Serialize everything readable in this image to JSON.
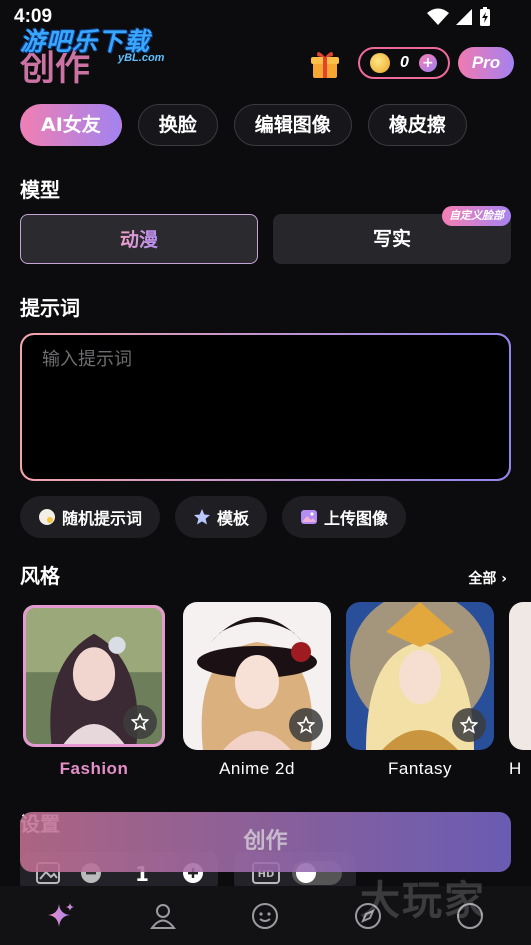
{
  "status_bar": {
    "time": "4:09"
  },
  "watermark": {
    "text": "游吧乐下载",
    "sub": "yBL.com",
    "corner": "大玩家"
  },
  "header": {
    "title": "创作",
    "coins": "0",
    "pro": "Pro"
  },
  "tabs": [
    {
      "label": "AI女友",
      "active": true
    },
    {
      "label": "换脸",
      "active": false
    },
    {
      "label": "编辑图像",
      "active": false
    },
    {
      "label": "橡皮擦",
      "active": false
    }
  ],
  "model": {
    "label": "模型",
    "options": [
      "动漫",
      "写实"
    ],
    "selected": "动漫",
    "custom_badge": "自定义脸部"
  },
  "prompt": {
    "label": "提示词",
    "placeholder": "输入提示词",
    "value": ""
  },
  "chips": [
    {
      "label": "随机提示词",
      "icon": "dice-icon"
    },
    {
      "label": "模板",
      "icon": "star-icon"
    },
    {
      "label": "上传图像",
      "icon": "image-icon"
    }
  ],
  "style": {
    "label": "风格",
    "see_all": "全部",
    "items": [
      {
        "name": "Fashion",
        "selected": true
      },
      {
        "name": "Anime 2d",
        "selected": false
      },
      {
        "name": "Fantasy",
        "selected": false
      },
      {
        "name": "H",
        "selected": false
      }
    ]
  },
  "settings": {
    "label": "设置",
    "count": "1"
  },
  "create_button": "创作",
  "colors": {
    "accent_pink": "#f07fb2",
    "accent_purple": "#a283f0",
    "background": "#0c0c0f"
  }
}
